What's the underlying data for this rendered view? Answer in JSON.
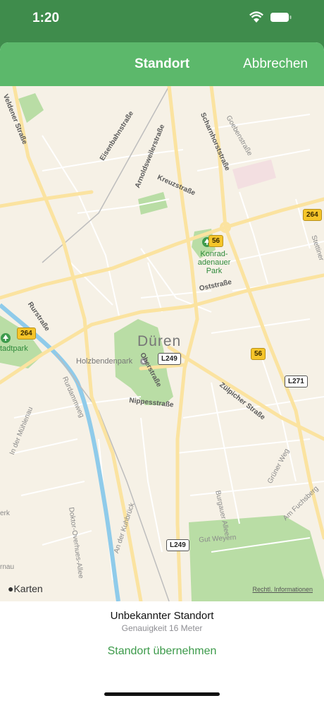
{
  "status_bar": {
    "time": "1:20"
  },
  "nav": {
    "title": "Standort",
    "cancel_label": "Abbrechen"
  },
  "map": {
    "city": "Düren",
    "streets": [
      "Veldener Straße",
      "Eisenbahnstraße",
      "Arnoldsweilerstraße",
      "Scharnhorststraße",
      "Goebenstraße",
      "Kreuzstraße",
      "Oststraße",
      "Oberstraße",
      "Rurstraße",
      "Rurdammweg",
      "Nippesstraße",
      "Zülpicher Straße",
      "In der Mühlenau",
      "Doktor-Overhues-Allee",
      "An der Kuhbrück",
      "Burgauer Allee",
      "Grüner Weg",
      "Am Fuchsberg",
      "Gut Weyern",
      "Stettiner",
      "erk",
      "rnau"
    ],
    "parks": [
      "Konrad-adenauer Park",
      "Holzbendenpark",
      "tadtpark"
    ],
    "route_shields": [
      "264",
      "56",
      "264",
      "56",
      "L249",
      "L271",
      "L249"
    ],
    "brand": "Karten",
    "legal": "Rechtl. Informationen"
  },
  "bottom": {
    "location": "Unbekannter Standort",
    "accuracy": "Genauigkeit 16 Meter",
    "adopt_label": "Standort übernehmen"
  }
}
